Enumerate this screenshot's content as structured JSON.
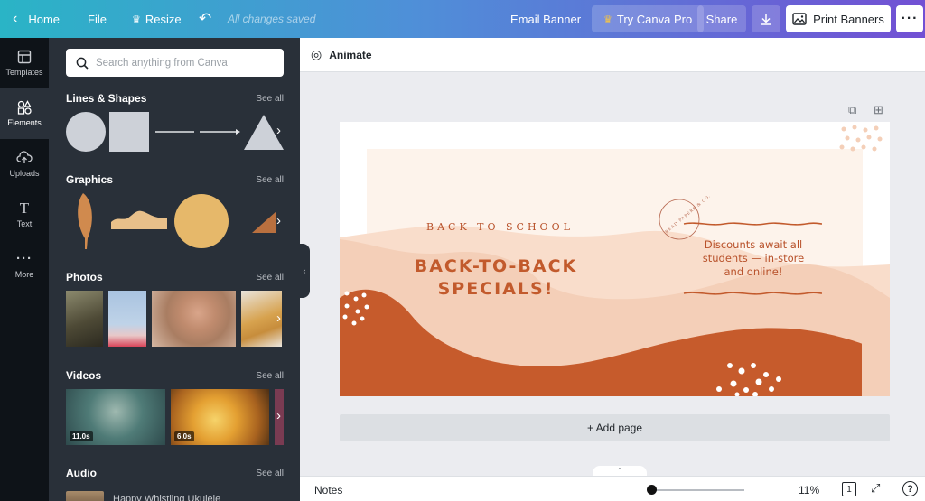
{
  "topbar": {
    "home": "Home",
    "file": "File",
    "resize": "Resize",
    "saved": "All changes saved",
    "title": "Email Banner",
    "try_pro": "Try Canva Pro",
    "share": "Share",
    "print": "Print Banners"
  },
  "rail": {
    "items": [
      {
        "label": "Templates",
        "icon": "template-icon"
      },
      {
        "label": "Elements",
        "icon": "shapes-icon"
      },
      {
        "label": "Uploads",
        "icon": "upload-icon"
      },
      {
        "label": "Text",
        "icon": "text-icon"
      },
      {
        "label": "More",
        "icon": "more-icon"
      }
    ]
  },
  "panel": {
    "search_placeholder": "Search anything from Canva",
    "see_all": "See all",
    "sections": {
      "lines": "Lines & Shapes",
      "graphics": "Graphics",
      "photos": "Photos",
      "videos": "Videos",
      "audio": "Audio"
    },
    "videos": [
      {
        "duration": "11.0s"
      },
      {
        "duration": "6.0s"
      }
    ],
    "audio_track": "Happy Whistling Ukulele"
  },
  "workspace": {
    "animate": "Animate",
    "add_page": "+ Add page",
    "notes": "Notes",
    "zoom": "11%",
    "page_number": "1",
    "help": "?"
  },
  "design": {
    "back_to_school": "BACK TO SCHOOL",
    "headline_1": "BACK-TO-BACK",
    "headline_2": "SPECIALS!",
    "discount_1": "Discounts await all",
    "discount_2": "students — in-store",
    "discount_3": "and online!",
    "stamp": "READ PAPERS & CO.",
    "colors": {
      "rust": "#c25a2c",
      "peach": "#f3c9b0",
      "cream": "#fdf1e8",
      "text": "#b8512a"
    }
  }
}
